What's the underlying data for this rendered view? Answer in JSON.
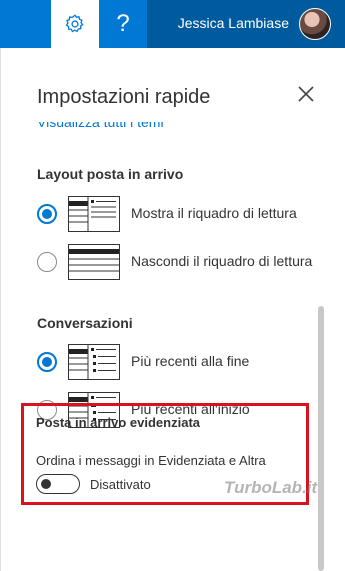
{
  "topbar": {
    "help_glyph": "?",
    "user_name": "Jessica Lambiase",
    "accent_color": "#0078d4",
    "user_area_color": "#005a9e"
  },
  "panel": {
    "title": "Impostazioni rapide",
    "view_all_link": "Visualizza tutti i temi",
    "layout_section": {
      "heading": "Layout posta in arrivo",
      "options": [
        {
          "label": "Mostra il riquadro di lettura",
          "selected": true,
          "icon": "reading-pane-shown-icon"
        },
        {
          "label": "Nascondi il riquadro di lettura",
          "selected": false,
          "icon": "reading-pane-hidden-icon"
        }
      ]
    },
    "conversations_section": {
      "heading": "Conversazioni",
      "options": [
        {
          "label": "Più recenti alla fine",
          "selected": true,
          "icon": "newest-bottom-icon"
        },
        {
          "label": "Più recenti all'inizio",
          "selected": false,
          "icon": "newest-top-icon"
        }
      ]
    },
    "focused_section": {
      "heading": "Posta in arrivo evidenziata",
      "description": "Ordina i messaggi in Evidenziata e Altra",
      "toggle_label": "Disattivato",
      "toggle_on": false,
      "highlight_color": "#d9121f"
    }
  },
  "watermark": "TurboLab.it"
}
